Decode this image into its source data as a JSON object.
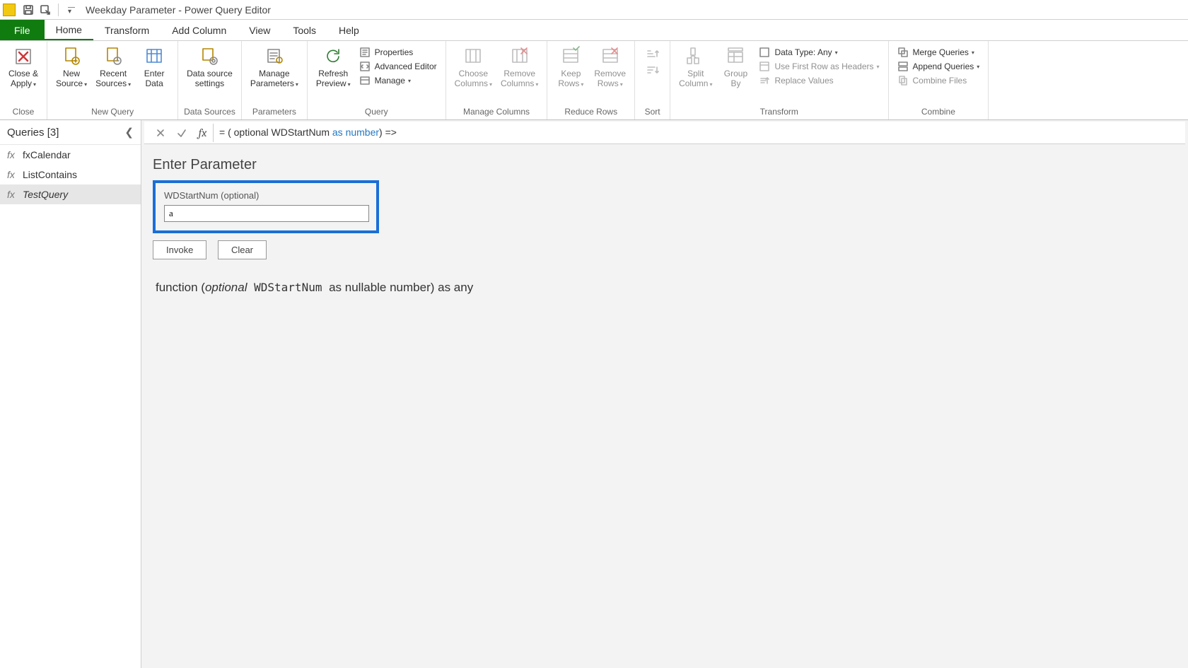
{
  "title": "Weekday Parameter - Power Query Editor",
  "menu": {
    "file": "File",
    "home": "Home",
    "transform": "Transform",
    "addcolumn": "Add Column",
    "view": "View",
    "tools": "Tools",
    "help": "Help"
  },
  "ribbon": {
    "close": {
      "closeapply": "Close &\nApply",
      "group": "Close"
    },
    "new": {
      "newsource": "New\nSource",
      "recentsources": "Recent\nSources",
      "enterdata": "Enter\nData",
      "group": "New Query"
    },
    "datasources": {
      "settings": "Data source\nsettings",
      "group": "Data Sources"
    },
    "parameters": {
      "manage": "Manage\nParameters",
      "group": "Parameters"
    },
    "query": {
      "refresh": "Refresh\nPreview",
      "properties": "Properties",
      "advanced": "Advanced Editor",
      "manage": "Manage",
      "group": "Query"
    },
    "columns": {
      "choose": "Choose\nColumns",
      "remove": "Remove\nColumns",
      "group": "Manage Columns"
    },
    "rows": {
      "keep": "Keep\nRows",
      "remove": "Remove\nRows",
      "group": "Reduce Rows"
    },
    "sort": {
      "group": "Sort"
    },
    "transform": {
      "split": "Split\nColumn",
      "groupby": "Group\nBy",
      "datatype": "Data Type: Any",
      "firstrow": "Use First Row as Headers",
      "replace": "Replace Values",
      "group": "Transform"
    },
    "combine": {
      "merge": "Merge Queries",
      "append": "Append Queries",
      "combinefiles": "Combine Files",
      "group": "Combine"
    }
  },
  "queries": {
    "header": "Queries [3]",
    "items": [
      "fxCalendar",
      "ListContains",
      "TestQuery"
    ],
    "selected": 2
  },
  "formula": {
    "prefix": "= ( optional WDStartNum ",
    "kw": "as number",
    "suffix": ") =>"
  },
  "param": {
    "title": "Enter Parameter",
    "label": "WDStartNum (optional)",
    "value": "a",
    "invoke": "Invoke",
    "clear": "Clear"
  },
  "signature": {
    "p1": "function (",
    "kw": "optional",
    "mono": " WDStartNum ",
    "p2": "as nullable number) as any"
  }
}
